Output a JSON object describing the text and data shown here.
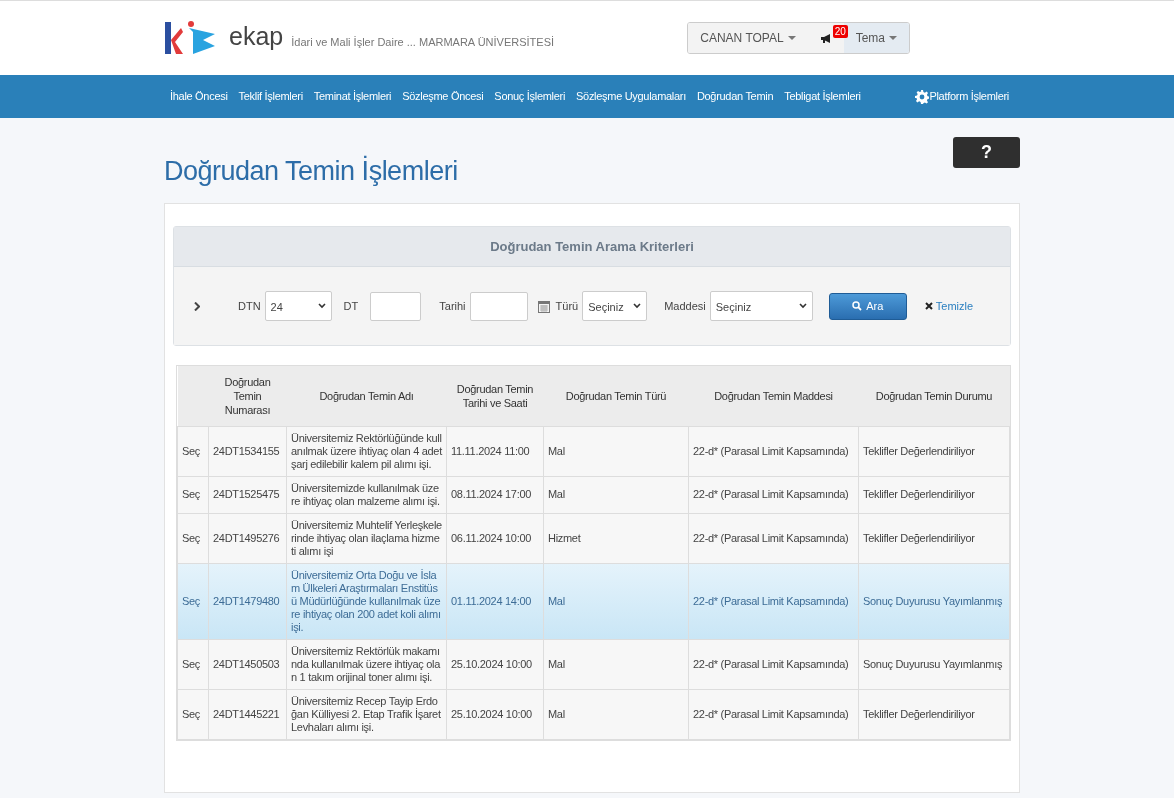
{
  "header": {
    "logo_text": "ekap",
    "subtitle": "İdari ve Mali İşler Daire ... MARMARA ÜNİVERSİTESİ",
    "user": "CANAN TOPAL",
    "notifications": "20",
    "theme": "Tema"
  },
  "nav": {
    "items": [
      "İhale Öncesi",
      "Teklif İşlemleri",
      "Teminat İşlemleri",
      "Sözleşme Öncesi",
      "Sonuç İşlemleri",
      "Sözleşme Uygulamaları",
      "Doğrudan Temin",
      "Tebligat İşlemleri"
    ],
    "platform": "Platform İşlemleri"
  },
  "page_title": "Doğrudan Temin İşlemleri",
  "help_button": "?",
  "search": {
    "title": "Doğrudan Temin Arama Kriterleri",
    "fields": [
      {
        "kind": "select",
        "label": "DTN",
        "value": "24"
      },
      {
        "kind": "input",
        "label": "DT"
      },
      {
        "kind": "date",
        "label": "Tarihi"
      },
      {
        "kind": "select",
        "label": "Türü",
        "value": "Seçiniz"
      },
      {
        "kind": "select",
        "label": "Maddesi",
        "value": "Seçiniz"
      }
    ],
    "search_button": "Ara",
    "clear_link": "Temizle"
  },
  "table": {
    "columns": [
      "Doğrudan Temin Numarası",
      "Doğrudan Temin Adı",
      "Doğrudan Temin Tarihi ve Saati",
      "Doğrudan Temin Türü",
      "Doğrudan Temin Maddesi",
      "Doğrudan Temin Durumu"
    ],
    "rows": [
      {
        "action": "Seç",
        "number": "24DT1534155",
        "name": "Üniversitemiz Rektörlüğünde kullanılmak üzere ihtiyaç olan 4 adet şarj edilebilir kalem pil alımı işi.",
        "date": "11.11.2024 11:00",
        "type": "Mal",
        "article": "22-d* (Parasal Limit Kapsamında)",
        "status": "Teklifler Değerlendiriliyor",
        "selected": false
      },
      {
        "action": "Seç",
        "number": "24DT1525475",
        "name": "Üniversitemizde kullanılmak üzere ihtiyaç olan malzeme alımı işi.",
        "date": "08.11.2024 17:00",
        "type": "Mal",
        "article": "22-d* (Parasal Limit Kapsamında)",
        "status": "Teklifler Değerlendiriliyor",
        "selected": false
      },
      {
        "action": "Seç",
        "number": "24DT1495276",
        "name": "Üniversitemiz Muhtelif Yerleşkelerinde ihtiyaç olan ilaçlama hizmeti alımı işi",
        "date": "06.11.2024 10:00",
        "type": "Hizmet",
        "article": "22-d* (Parasal Limit Kapsamında)",
        "status": "Teklifler Değerlendiriliyor",
        "selected": false
      },
      {
        "action": "Seç",
        "number": "24DT1479480",
        "name": "Üniversitemiz Orta Doğu ve İslam Ülkeleri Araştırmaları Enstitüsü Müdürlüğünde kullanılmak üzere ihtiyaç olan 200 adet koli alımı işi.",
        "date": "01.11.2024 14:00",
        "type": "Mal",
        "article": "22-d* (Parasal Limit Kapsamında)",
        "status": "Sonuç Duyurusu Yayımlanmış",
        "selected": true
      },
      {
        "action": "Seç",
        "number": "24DT1450503",
        "name": "Üniversitemiz Rektörlük makamında kullanılmak üzere ihtiyaç olan 1 takım orijinal toner alımı işi.",
        "date": "25.10.2024 10:00",
        "type": "Mal",
        "article": "22-d* (Parasal Limit Kapsamında)",
        "status": "Sonuç Duyurusu Yayımlanmış",
        "selected": false
      },
      {
        "action": "Seç",
        "number": "24DT1445221",
        "name": "Üniversitemiz Recep Tayip Erdoğan Külliyesi 2. Etap Trafik İşaret Levhaları alımı işi.",
        "date": "25.10.2024 10:00",
        "type": "Mal",
        "article": "22-d* (Parasal Limit Kapsamında)",
        "status": "Teklifler Değerlendiriliyor",
        "selected": false
      }
    ]
  }
}
